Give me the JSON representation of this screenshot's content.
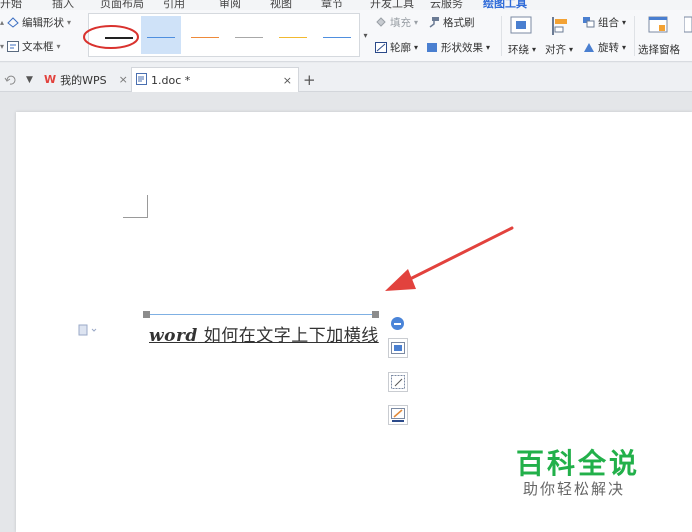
{
  "menu": {
    "items": [
      {
        "label": "开始"
      },
      {
        "label": "插入"
      },
      {
        "label": "页面布局"
      },
      {
        "label": "引用"
      },
      {
        "label": "审阅"
      },
      {
        "label": "视图"
      },
      {
        "label": "章节"
      },
      {
        "label": "开发工具"
      },
      {
        "label": "云服务"
      },
      {
        "label": "绘图工具"
      }
    ]
  },
  "ribbon": {
    "edit_shape": "编辑形状",
    "text_box": "文本框",
    "fill": "填充",
    "format_painter": "格式刷",
    "outline": "轮廓",
    "shape_effects": "形状效果",
    "wrap": "环绕",
    "align": "对齐",
    "group": "组合",
    "rotate": "旋转",
    "selection_pane": "选择窗格"
  },
  "line_styles": [
    {
      "color": "#222222"
    },
    {
      "color": "#4f8fdf"
    },
    {
      "color": "#ee8a3a"
    },
    {
      "color": "#a8a8a8"
    },
    {
      "color": "#f2b930"
    },
    {
      "color": "#4f8fdf"
    }
  ],
  "tabs": {
    "home": "我的WPS",
    "doc": "1.doc *",
    "close": "×",
    "new": "+"
  },
  "document": {
    "word": "word",
    "text": " 如何在文字上下加横线"
  },
  "watermark": {
    "title": "百科全说",
    "subtitle": "助你轻松解决"
  },
  "colors": {
    "accent": "#2f6bd8",
    "arrow": "#e2423d",
    "circle": "#d9322e",
    "watermark_green": "#22b04a"
  }
}
